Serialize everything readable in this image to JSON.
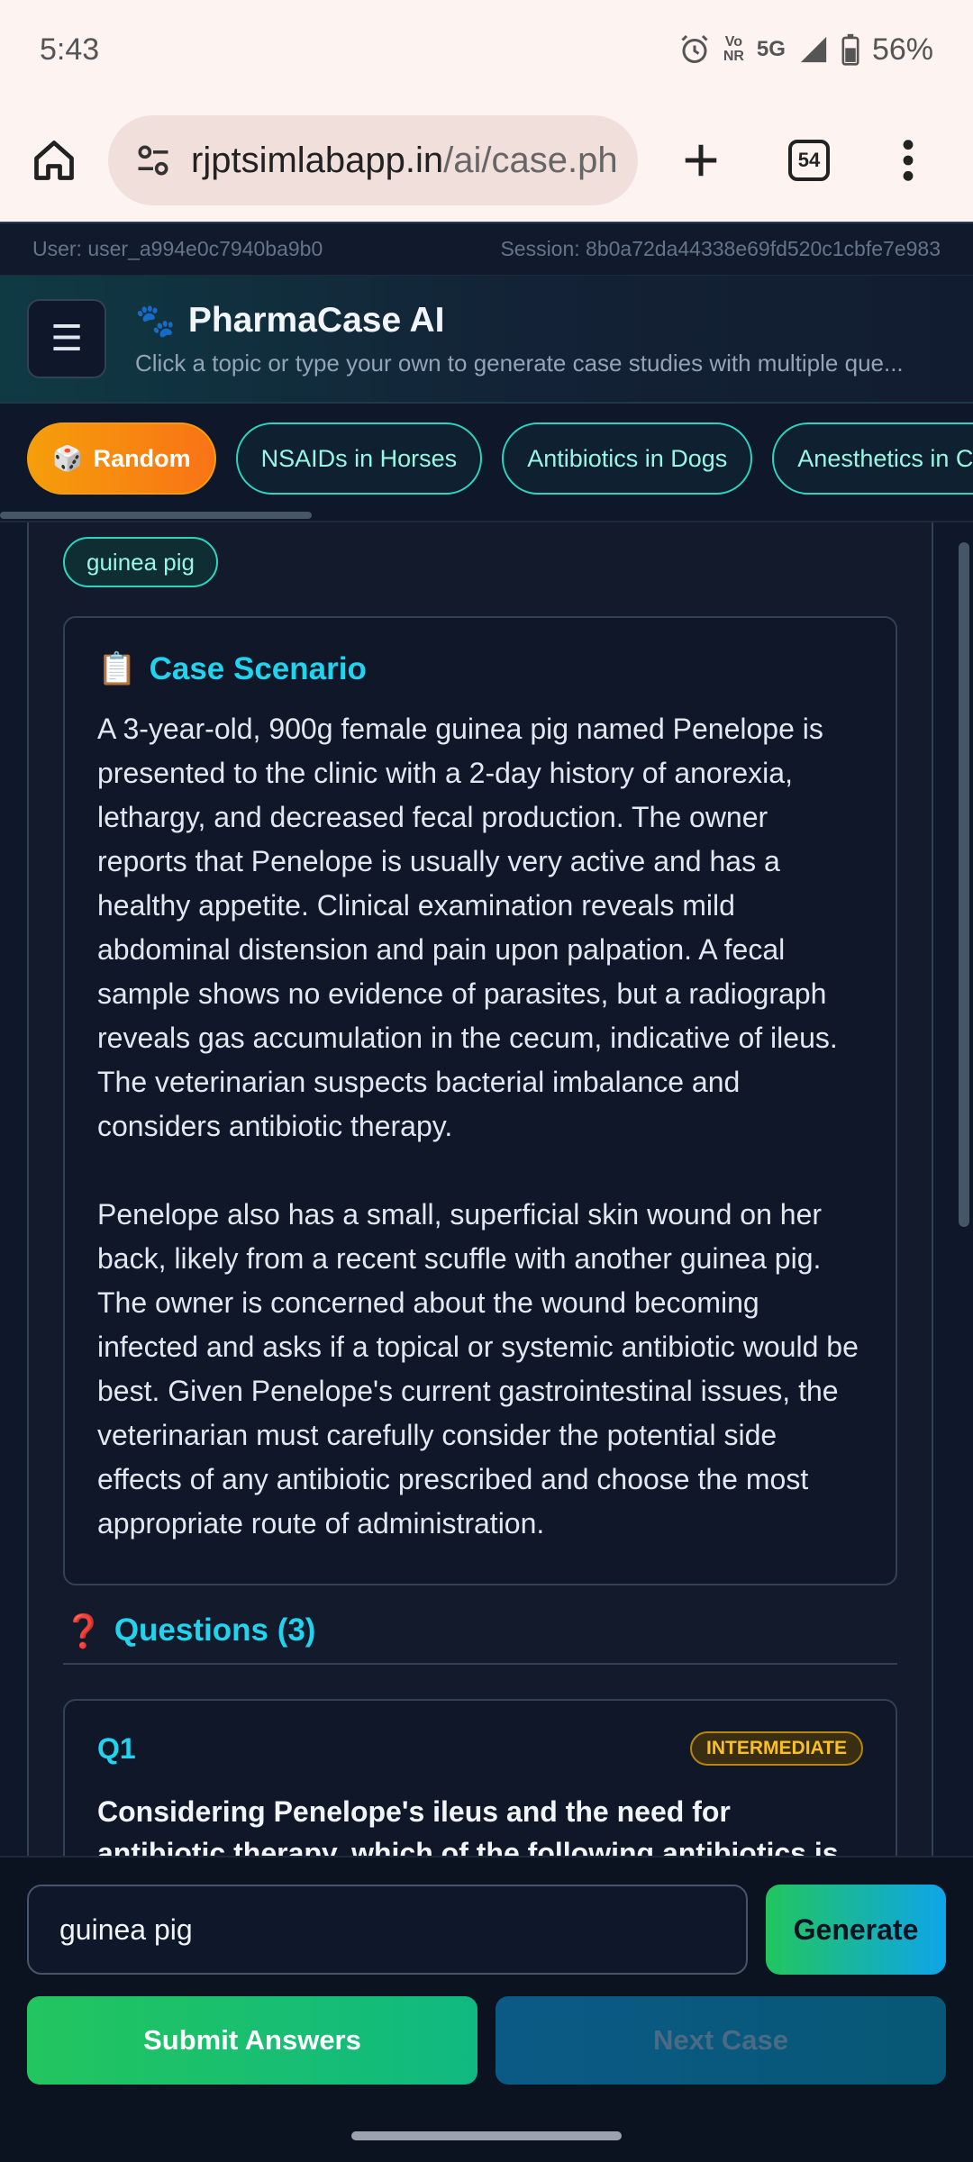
{
  "status_bar": {
    "time": "5:43",
    "signal_top": "Vo) 5G",
    "volte": "Vo",
    "nr": "NR",
    "network": "5G",
    "battery": "56%"
  },
  "browser": {
    "url_host": "rjptsimlabapp.in",
    "url_path": "/ai/case.ph",
    "tab_count": "54"
  },
  "session": {
    "user": "User: user_a994e0c7940ba9b0",
    "session": "Session: 8b0a72da44338e69fd520c1cbfe7e983"
  },
  "app": {
    "title": "PharmaCase AI",
    "subtitle": "Click a topic or type your own to generate case studies with multiple que..."
  },
  "topics": [
    {
      "label": "Random",
      "icon": "dice-icon"
    },
    {
      "label": "NSAIDs in Horses"
    },
    {
      "label": "Antibiotics in Dogs"
    },
    {
      "label": "Anesthetics in Cats"
    }
  ],
  "case": {
    "tag": "guinea pig",
    "heading": "Case Scenario",
    "paragraph1": "A 3-year-old, 900g female guinea pig named Penelope is presented to the clinic with a 2-day history of anorexia, lethargy, and decreased fecal production. The owner reports that Penelope is usually very active and has a healthy appetite. Clinical examination reveals mild abdominal distension and pain upon palpation. A fecal sample shows no evidence of parasites, but a radiograph reveals gas accumulation in the cecum, indicative of ileus. The veterinarian suspects bacterial imbalance and considers antibiotic therapy.",
    "paragraph2": "Penelope also has a small, superficial skin wound on her back, likely from a recent scuffle with another guinea pig. The owner is concerned about the wound becoming infected and asks if a topical or systemic antibiotic would be best. Given Penelope's current gastrointestinal issues, the veterinarian must carefully consider the potential side effects of any antibiotic prescribed and choose the most appropriate route of administration."
  },
  "questions": {
    "heading": "Questions (3)",
    "items": [
      {
        "number": "Q1",
        "difficulty": "INTERMEDIATE",
        "text": "Considering Penelope's ileus and the need for antibiotic therapy, which of the following antibiotics is generally"
      }
    ]
  },
  "controls": {
    "input_value": "guinea pig",
    "generate_label": "Generate",
    "submit_label": "Submit Answers",
    "next_label": "Next Case"
  },
  "colors": {
    "accent": "#22d3ee",
    "chip_border": "#2dd4bf",
    "random_chip": "#f97316",
    "badge": "#fbbf24",
    "submit": "#22c55e"
  }
}
